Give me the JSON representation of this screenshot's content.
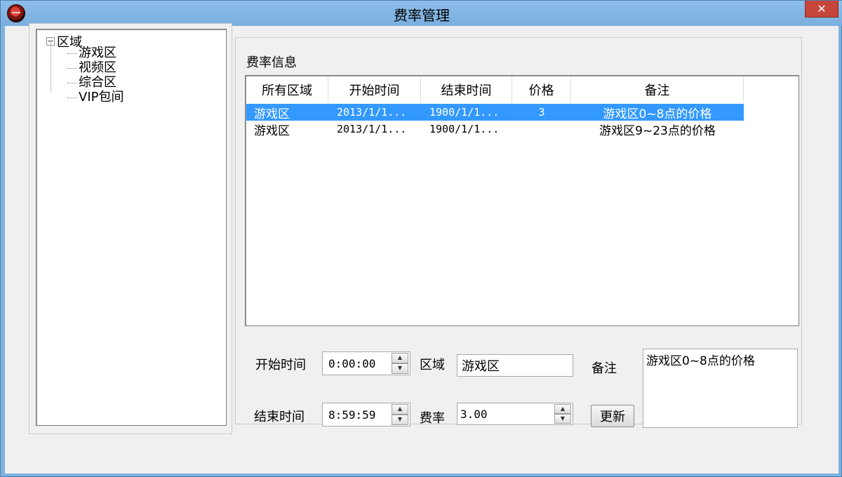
{
  "window": {
    "title": "费率管理",
    "close_label": "✕"
  },
  "tree": {
    "root_label": "区域",
    "expander": "−",
    "items": [
      {
        "label": "游戏区"
      },
      {
        "label": "视频区"
      },
      {
        "label": "综合区"
      },
      {
        "label": "VIP包间"
      }
    ]
  },
  "rate_info": {
    "group_label": "费率信息",
    "columns": [
      "所有区域",
      "开始时间",
      "结束时间",
      "价格",
      "备注"
    ],
    "rows": [
      {
        "area": "游戏区",
        "start": "2013/1/1...",
        "end": "1900/1/1...",
        "price": "3",
        "note": "游戏区0~8点的价格",
        "selected": true
      },
      {
        "area": "游戏区",
        "start": "2013/1/1...",
        "end": "1900/1/1...",
        "price": "",
        "note": "游戏区9~23点的价格",
        "selected": false
      }
    ]
  },
  "form": {
    "start_label": "开始时间",
    "start_value": "0:00:00",
    "end_label": "结束时间",
    "end_value": "8:59:59",
    "area_label": "区域",
    "area_value": "游戏区",
    "rate_label": "费率",
    "rate_value": "3.00",
    "note_label": "备注",
    "note_value": "游戏区0~8点的价格",
    "update_button": "更新"
  },
  "colors": {
    "titlebar": "#7fb2df",
    "selection": "#3399ff",
    "close": "#c7463a"
  }
}
